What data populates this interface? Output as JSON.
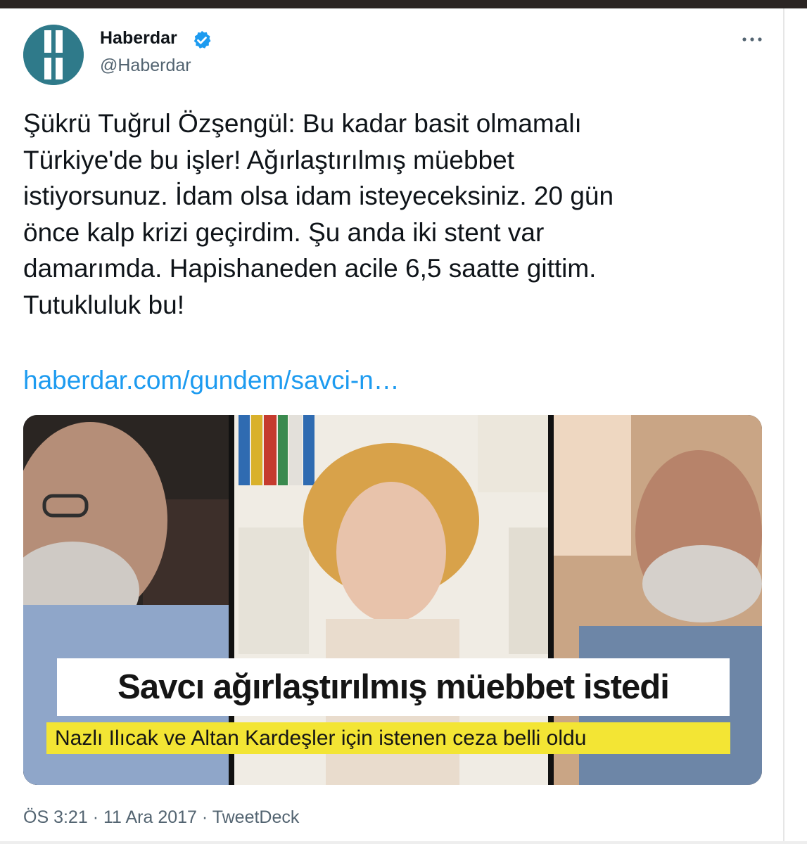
{
  "author": {
    "display_name": "Haberdar",
    "handle": "@Haberdar",
    "verified": true,
    "avatar_letter": "H"
  },
  "tweet": {
    "lines": [
      "Şükrü Tuğrul Özşengül: Bu kadar basit olmamalı",
      "Türkiye'de bu işler! Ağırlaştırılmış müebbet",
      "istiyorsunuz. İdam olsa idam isteyeceksiniz. 20 gün",
      "önce kalp krizi geçirdim. Şu anda iki stent var",
      "damarımda. Hapishaneden acile 6,5 saatte gittim.",
      "Tutukluluk bu!"
    ],
    "link_text": "haberdar.com/gundem/savci-n…"
  },
  "media": {
    "headline": "Savcı ağırlaştırılmış müebbet istedi",
    "subheadline": "Nazlı Ilıcak ve Altan Kardeşler için istenen ceza belli oldu"
  },
  "meta": {
    "time": "ÖS 3:21",
    "separator": "·",
    "date": "11 Ara 2017",
    "source": "TweetDeck"
  },
  "colors": {
    "link": "#1d9bf0",
    "verified": "#1d9bf0",
    "avatar_bg": "#2f7a8a",
    "subheadline_bg": "#f3e534"
  },
  "icons": [
    "verified-badge-icon",
    "more-options-icon"
  ]
}
